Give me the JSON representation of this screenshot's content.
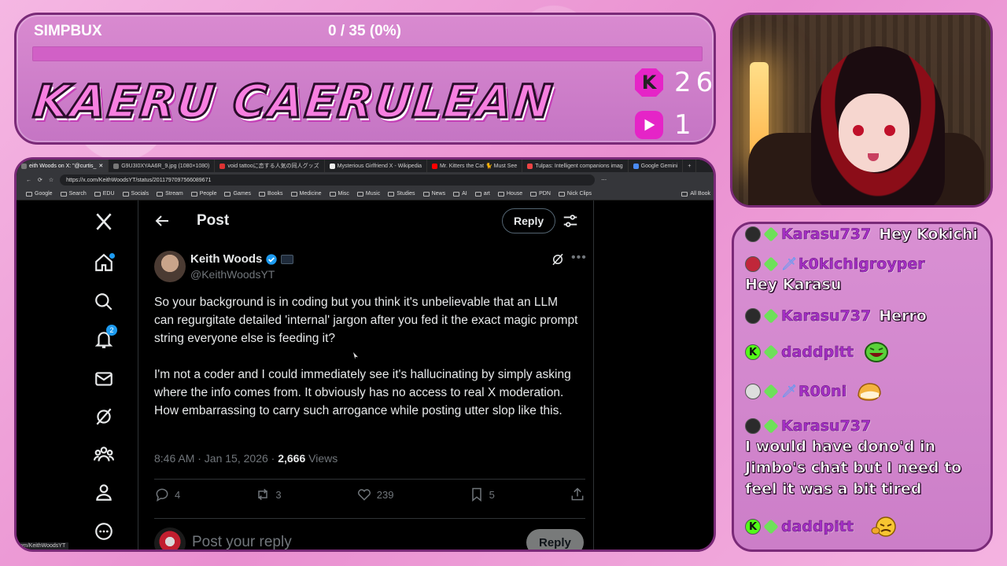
{
  "overlay": {
    "simpbux_label": "SIMPBUX",
    "simpbux_progress": "0 / 35 (0%)",
    "simpbux_fraction": 0,
    "channel_name": "KAERU CAERULEAN",
    "kick_count": "26",
    "twitch_count": "1",
    "kick_glyph": "K",
    "colors": {
      "accent": "#e524c7",
      "border": "#7a2a78",
      "panel": "#d98ad0"
    }
  },
  "chat": [
    {
      "user": "Karasu737",
      "message": "Hey Kokichi",
      "badges": [
        "avatar",
        "diamond"
      ]
    },
    {
      "user": "k0kichigroyper",
      "message": "Hey Karasu",
      "badges": [
        "avatar",
        "diamond",
        "sword"
      ]
    },
    {
      "user": "Karasu737",
      "message": "Herro",
      "badges": [
        "avatar",
        "diamond"
      ]
    },
    {
      "user": "daddpitt",
      "message": "",
      "badges": [
        "kick",
        "diamond"
      ],
      "emote": "laughing-face-emote"
    },
    {
      "user": "R00ni",
      "message": "",
      "badges": [
        "avatar",
        "diamond",
        "sword"
      ],
      "emote": "bread-emote"
    },
    {
      "user": "Karasu737",
      "message": "I would have dono'd in Jimbo's chat but I need to feel it was a bit tired",
      "badges": [
        "avatar",
        "diamond"
      ]
    },
    {
      "user": "daddpitt",
      "message": "",
      "badges": [
        "kick",
        "diamond"
      ],
      "emote": "angry-face-emote"
    }
  ],
  "browser": {
    "tabs": [
      {
        "label": "eith Woods on X: \"@curtis_",
        "active": true
      },
      {
        "label": "G9U3I0XYAA6R_9.jpg (1080×1080)",
        "active": false
      },
      {
        "label": "void tattooに恋する人気の同人グッズ",
        "active": false
      },
      {
        "label": "Mysterious Girlfriend X - Wikipedia",
        "active": false
      },
      {
        "label": "Mr. Kitters the Cat 🐈 Must See",
        "active": false
      },
      {
        "label": "Tulpas: Intelligent companions imag",
        "active": false
      },
      {
        "label": "Google Gemini",
        "active": false
      }
    ],
    "url": "https://x.com/KeithWoodsYT/status/2011797097566089671",
    "bookmarks": [
      "Google",
      "Search",
      "EDU",
      "Socials",
      "Stream",
      "People",
      "Games",
      "Books",
      "Medicine",
      "Misc",
      "Music",
      "Studies",
      "News",
      "AI",
      "art",
      "House",
      "PDN",
      "Nick Clips"
    ],
    "bookmarks_all": "All Book",
    "status_url": "om/KeithWoodsYT"
  },
  "x": {
    "header_title": "Post",
    "reply_pill": "Reply",
    "notifications_count": "2",
    "author_name": "Keith Woods",
    "author_handle": "@KeithWoodsYT",
    "body": "So your background is in coding but you think it's unbelievable that an LLM can regurgitate detailed 'internal' jargon after you fed it the exact magic prompt string everyone else is feeding it?\n\nI'm not a coder and I could immediately see it's hallucinating by simply asking where the info comes from. It obviously has no access to real X moderation. How embarrassing to carry such arrogance while posting utter slop like this.",
    "timestamp": "8:46 AM · Jan 15, 2026 · ",
    "views_count": "2,666",
    "views_label": " Views",
    "replies": "4",
    "reposts": "3",
    "likes": "239",
    "bookmarks": "5",
    "reply_placeholder": "Post your reply",
    "reply_button": "Reply"
  }
}
